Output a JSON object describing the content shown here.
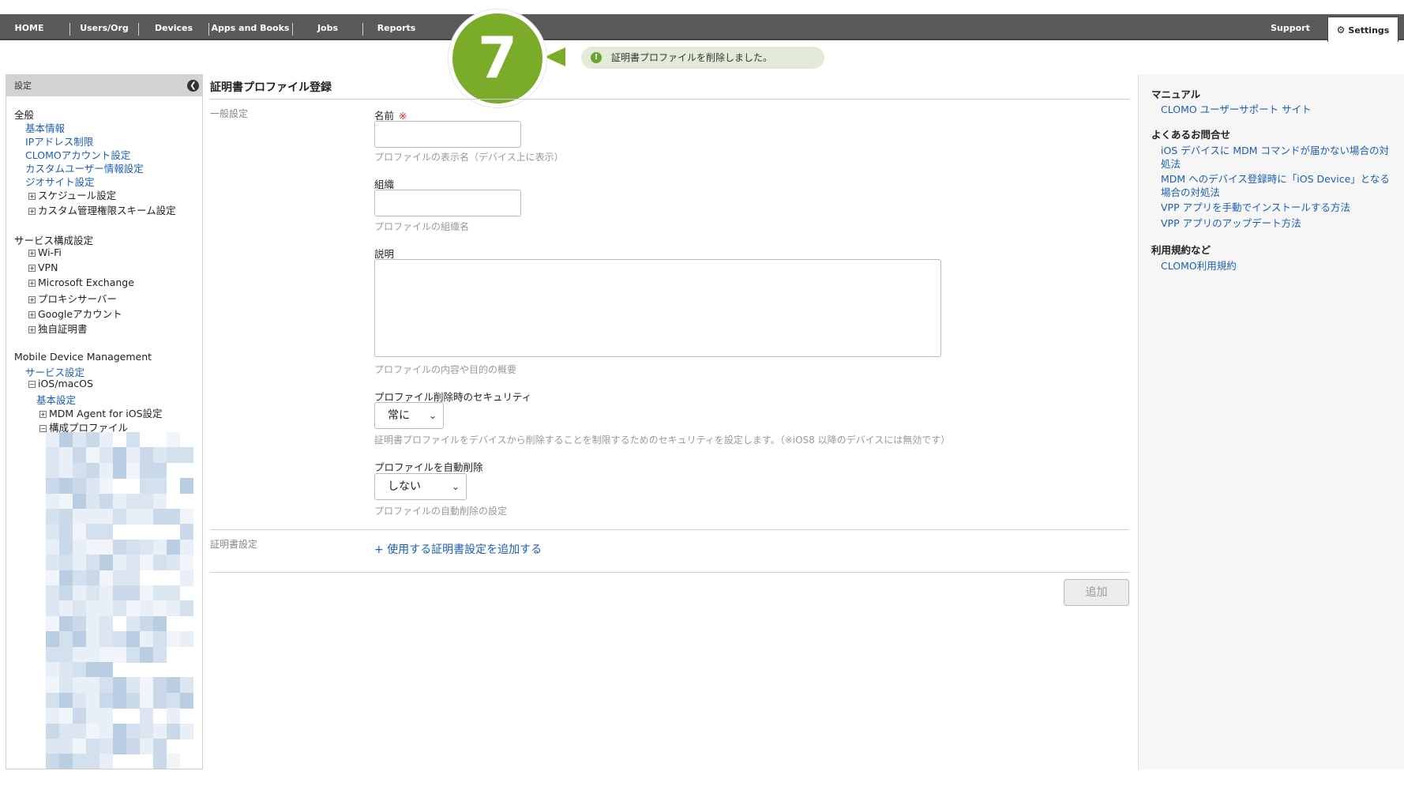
{
  "nav": {
    "items": [
      "HOME",
      "Users/Org",
      "Devices",
      "Apps and Books",
      "Jobs",
      "Reports"
    ],
    "support": "Support",
    "settings": "Settings"
  },
  "step": {
    "number": "7"
  },
  "toast": {
    "message": "証明書プロファイルを削除しました。"
  },
  "sidebar": {
    "header": "設定",
    "general": {
      "title": "全般",
      "links": [
        "基本情報",
        "IPアドレス制限",
        "CLOMOアカウント設定",
        "カスタムユーザー情報設定",
        "ジオサイト設定"
      ],
      "tree": [
        "スケジュール設定",
        "カスタム管理権限スキーム設定"
      ]
    },
    "service": {
      "title": "サービス構成設定",
      "tree": [
        "Wi-Fi",
        "VPN",
        "Microsoft Exchange",
        "プロキシサーバー",
        "Googleアカウント",
        "独自証明書"
      ]
    },
    "mdm": {
      "title": "Mobile Device Management",
      "service_link": "サービス設定",
      "ios": "iOS/macOS",
      "basic_link": "基本設定",
      "agent": "MDM Agent for iOS設定",
      "config": "構成プロファイル"
    }
  },
  "form": {
    "title": "証明書プロファイル登録",
    "general_section": "一般設定",
    "name_label": "名前",
    "required_mark": "※",
    "name_hint": "プロファイルの表示名（デバイス上に表示）",
    "org_label": "組織",
    "org_hint": "プロファイルの組織名",
    "desc_label": "説明",
    "desc_hint": "プロファイルの内容や目的の概要",
    "security_label": "プロファイル削除時のセキュリティ",
    "security_value": "常に",
    "security_hint": "証明書プロファイルをデバイスから削除することを制限するためのセキュリティを設定します。（※iOS8 以降のデバイスには無効です）",
    "auto_delete_label": "プロファイルを自動削除",
    "auto_delete_value": "しない",
    "auto_delete_hint": "プロファイルの自動削除の設定",
    "cert_section": "証明書設定",
    "add_cert_link": "+ 使用する証明書設定を追加する",
    "submit": "追加"
  },
  "right": {
    "manual_title": "マニュアル",
    "manual_link": "CLOMO ユーザーサポート サイト",
    "faq_title": "よくあるお問合せ",
    "faq_links": [
      "iOS デバイスに MDM コマンドが届かない場合の対処法",
      "MDM へのデバイス登録時に「iOS Device」となる場合の対処法",
      "VPP アプリを手動でインストールする方法",
      "VPP アプリのアップデート方法"
    ],
    "terms_title": "利用規約など",
    "terms_link": "CLOMO利用規約"
  },
  "colors": {
    "nav_bg": "#5a5a5a",
    "badge_green": "#7aac2a",
    "toast_bg": "#e4ead8",
    "link_blue": "#1c5fb0",
    "required_red": "#d6232a"
  }
}
